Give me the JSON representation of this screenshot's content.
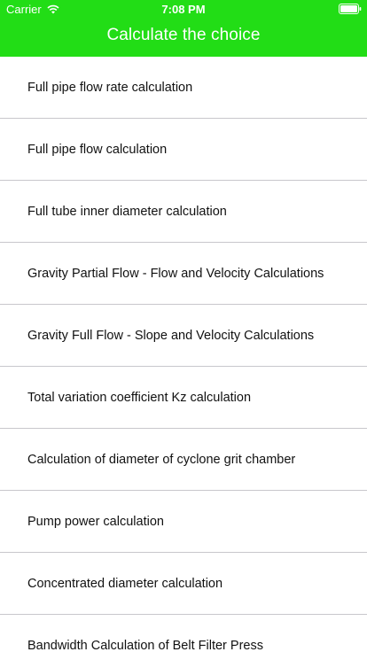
{
  "status_bar": {
    "carrier": "Carrier",
    "time": "7:08 PM"
  },
  "nav": {
    "title": "Calculate the choice"
  },
  "colors": {
    "header_bg": "#22dd16",
    "header_text": "#ffffff",
    "separator": "#c8c7cc"
  },
  "icons": {
    "wifi": "wifi-icon",
    "battery": "battery-icon"
  },
  "items": [
    {
      "label": "Full pipe flow rate calculation"
    },
    {
      "label": "Full pipe flow calculation"
    },
    {
      "label": "Full tube inner diameter calculation"
    },
    {
      "label": "Gravity Partial Flow - Flow and Velocity Calculations"
    },
    {
      "label": "Gravity Full Flow - Slope and Velocity Calculations"
    },
    {
      "label": "Total variation coefficient Kz calculation"
    },
    {
      "label": "Calculation of diameter of cyclone grit chamber"
    },
    {
      "label": "Pump power calculation"
    },
    {
      "label": "Concentrated diameter calculation"
    },
    {
      "label": "Bandwidth Calculation of Belt Filter Press"
    }
  ]
}
